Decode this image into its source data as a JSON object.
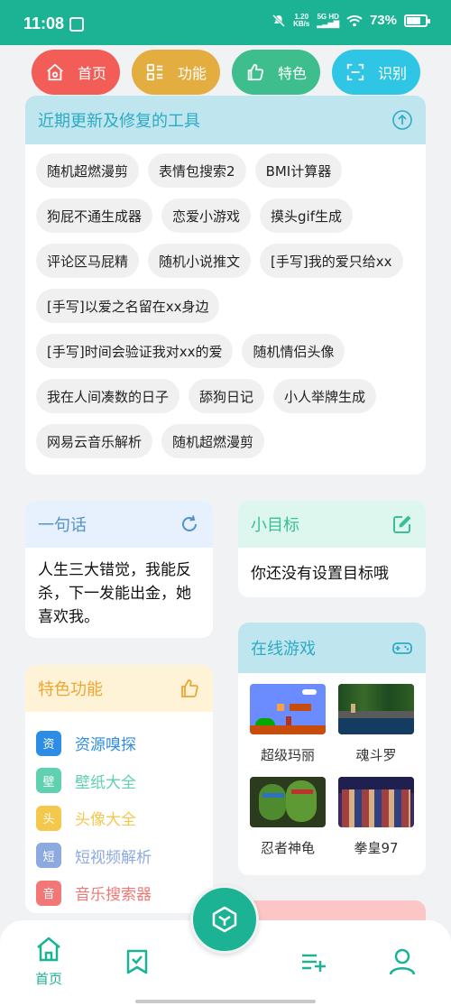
{
  "status": {
    "time": "11:08",
    "net_speed_value": "1.20",
    "net_speed_unit": "KB/s",
    "network": "5G HD",
    "battery_percent": "73%",
    "battery_level": 0.73
  },
  "topnav": [
    {
      "label": "首页",
      "color": "#f25d57",
      "icon": "home-icon"
    },
    {
      "label": "功能",
      "color": "#e3ad3f",
      "icon": "grid-icon"
    },
    {
      "label": "特色",
      "color": "#3ebd8d",
      "icon": "thumbs-up-icon"
    },
    {
      "label": "识别",
      "color": "#2ec6e4",
      "icon": "scan-icon"
    }
  ],
  "tools": {
    "title": "近期更新及修复的工具",
    "items": [
      "随机超燃漫剪",
      "表情包搜索2",
      "BMI计算器",
      "狗屁不通生成器",
      "恋爱小游戏",
      "摸头gif生成",
      "评论区马屁精",
      "随机小说推文",
      "[手写]我的爱只给xx",
      "[手写]以爱之名留在xx身边",
      "[手写]时间会验证我对xx的爱",
      "随机情侣头像",
      "我在人间凑数的日子",
      "舔狗日记",
      "小人举牌生成",
      "网易云音乐解析",
      "随机超燃漫剪"
    ]
  },
  "quote": {
    "title": "一句话",
    "text": "人生三大错觉，我能反杀，下一发能出金，她喜欢我。"
  },
  "goal": {
    "title": "小目标",
    "text": "你还没有设置目标哦"
  },
  "feature": {
    "title": "特色功能",
    "items": [
      {
        "badge": "资",
        "label": "资源嗅探",
        "color": "#2d8de4"
      },
      {
        "badge": "壁",
        "label": "壁纸大全",
        "color": "#5fd1b0"
      },
      {
        "badge": "头",
        "label": "头像大全",
        "color": "#f3c84c"
      },
      {
        "badge": "短",
        "label": "短视频解析",
        "color": "#8ca9e0"
      },
      {
        "badge": "音",
        "label": "音乐搜索器",
        "color": "#f27878"
      }
    ]
  },
  "games": {
    "title": "在线游戏",
    "items": [
      {
        "label": "超级玛丽"
      },
      {
        "label": "魂斗罗"
      },
      {
        "label": "忍者神龟"
      },
      {
        "label": "拳皇97"
      }
    ]
  },
  "tabbar": {
    "home_label": "首页"
  },
  "colors": {
    "brand": "#1bb394",
    "tools_header": "#bfe6ee",
    "quote_header": "#e6f1fd",
    "goal_header": "#ddf6ee",
    "feature_header": "#fff3d7"
  }
}
